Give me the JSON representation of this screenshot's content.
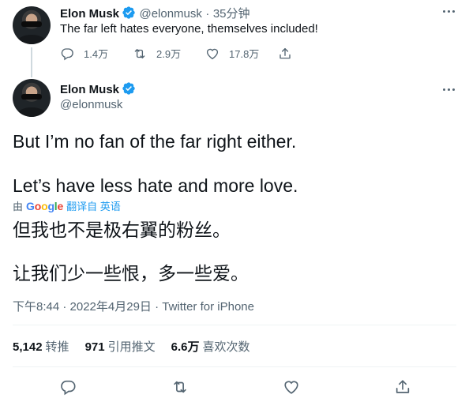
{
  "reply_tweet": {
    "name": "Elon Musk",
    "handle": "@elonmusk",
    "separator": "·",
    "time": "35分钟",
    "text": "The far left hates everyone, themselves included!",
    "replies": "1.4万",
    "retweets": "2.9万",
    "likes": "17.8万"
  },
  "main_tweet": {
    "name": "Elon Musk",
    "handle": "@elonmusk",
    "line1": "But I’m no fan of the far right either.",
    "line2": "Let’s have less hate and more love.",
    "translated_by": "由",
    "translate_provider": "Google",
    "translate_link": "翻译自 英语",
    "translated_line1": "但我也不是极右翼的粉丝。",
    "translated_line2": "让我们少一些恨，多一些爱。",
    "timestamp": "下午8:44 · 2022年4月29日 · Twitter for iPhone",
    "stats": [
      {
        "value": "5,142",
        "label": "转推"
      },
      {
        "value": "971",
        "label": "引用推文"
      },
      {
        "value": "6.6万",
        "label": "喜欢次数"
      }
    ]
  },
  "colors": {
    "accent": "#1d9bf0",
    "secondary_text": "#536471",
    "divider": "#eff3f4"
  },
  "icons": {
    "reply": "reply-icon",
    "retweet": "retweet-icon",
    "like": "heart-icon",
    "share": "share-icon",
    "verified": "verified-badge-icon",
    "more": "more-icon"
  }
}
